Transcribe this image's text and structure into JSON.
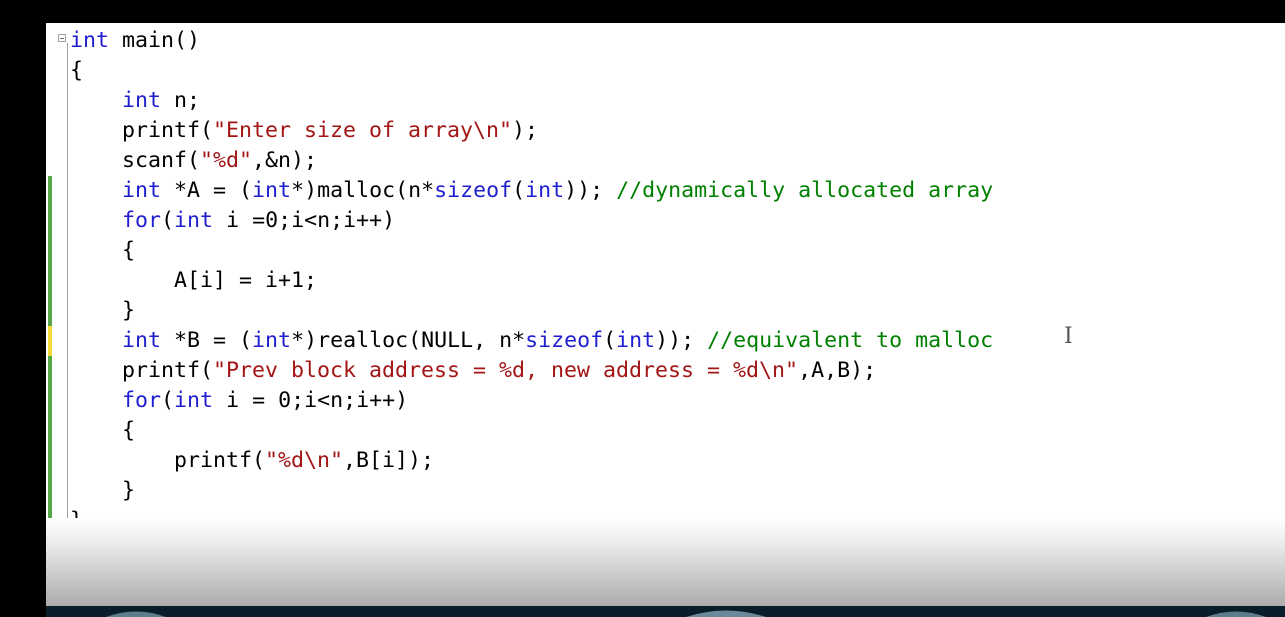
{
  "editor": {
    "lines": [
      {
        "indent": "",
        "tokens": [
          {
            "t": "int",
            "k": "kw"
          },
          {
            "t": " main()",
            "k": ""
          }
        ]
      },
      {
        "indent": "",
        "tokens": [
          {
            "t": "{",
            "k": ""
          }
        ]
      },
      {
        "indent": "    ",
        "tokens": [
          {
            "t": "int",
            "k": "kw"
          },
          {
            "t": " n;",
            "k": ""
          }
        ]
      },
      {
        "indent": "    ",
        "tokens": [
          {
            "t": "printf(",
            "k": ""
          },
          {
            "t": "\"Enter size of array\\n\"",
            "k": "str"
          },
          {
            "t": ");",
            "k": ""
          }
        ]
      },
      {
        "indent": "    ",
        "tokens": [
          {
            "t": "scanf(",
            "k": ""
          },
          {
            "t": "\"%d\"",
            "k": "str"
          },
          {
            "t": ",&n);",
            "k": ""
          }
        ]
      },
      {
        "indent": "    ",
        "tokens": [
          {
            "t": "int",
            "k": "kw"
          },
          {
            "t": " *A = (",
            "k": ""
          },
          {
            "t": "int",
            "k": "kw"
          },
          {
            "t": "*)malloc(n*",
            "k": ""
          },
          {
            "t": "sizeof",
            "k": "kw"
          },
          {
            "t": "(",
            "k": ""
          },
          {
            "t": "int",
            "k": "kw"
          },
          {
            "t": ")); ",
            "k": ""
          },
          {
            "t": "//dynamically allocated array",
            "k": "cm"
          }
        ]
      },
      {
        "indent": "    ",
        "tokens": [
          {
            "t": "for",
            "k": "kw"
          },
          {
            "t": "(",
            "k": ""
          },
          {
            "t": "int",
            "k": "kw"
          },
          {
            "t": " i =0;i<n;i++)",
            "k": ""
          }
        ]
      },
      {
        "indent": "    ",
        "tokens": [
          {
            "t": "{",
            "k": ""
          }
        ]
      },
      {
        "indent": "        ",
        "tokens": [
          {
            "t": "A[i] = i+1;",
            "k": ""
          }
        ]
      },
      {
        "indent": "    ",
        "tokens": [
          {
            "t": "}",
            "k": ""
          }
        ]
      },
      {
        "indent": "    ",
        "tokens": [
          {
            "t": "int",
            "k": "kw"
          },
          {
            "t": " *B = (",
            "k": ""
          },
          {
            "t": "int",
            "k": "kw"
          },
          {
            "t": "*)realloc(NULL, n*",
            "k": ""
          },
          {
            "t": "sizeof",
            "k": "kw"
          },
          {
            "t": "(",
            "k": ""
          },
          {
            "t": "int",
            "k": "kw"
          },
          {
            "t": ")); ",
            "k": ""
          },
          {
            "t": "//equivalent to malloc",
            "k": "cm"
          }
        ]
      },
      {
        "indent": "    ",
        "tokens": [
          {
            "t": "printf(",
            "k": ""
          },
          {
            "t": "\"Prev block address = %d, new address = %d\\n\"",
            "k": "str"
          },
          {
            "t": ",A,B);",
            "k": ""
          }
        ]
      },
      {
        "indent": "    ",
        "tokens": [
          {
            "t": "for",
            "k": "kw"
          },
          {
            "t": "(",
            "k": ""
          },
          {
            "t": "int",
            "k": "kw"
          },
          {
            "t": " i = 0;i<n;i++)",
            "k": ""
          }
        ]
      },
      {
        "indent": "    ",
        "tokens": [
          {
            "t": "{",
            "k": ""
          }
        ]
      },
      {
        "indent": "        ",
        "tokens": [
          {
            "t": "printf(",
            "k": ""
          },
          {
            "t": "\"%d\\n\"",
            "k": "str"
          },
          {
            "t": ",B[i]);",
            "k": ""
          }
        ]
      },
      {
        "indent": "    ",
        "tokens": [
          {
            "t": "}",
            "k": ""
          }
        ]
      },
      {
        "indent": "",
        "tokens": [
          {
            "t": "}",
            "k": ""
          }
        ]
      }
    ],
    "change_markers": [
      {
        "line": 5,
        "status": "saved"
      },
      {
        "line": 6,
        "status": "saved"
      },
      {
        "line": 7,
        "status": "saved"
      },
      {
        "line": 8,
        "status": "saved"
      },
      {
        "line": 9,
        "status": "saved"
      },
      {
        "line": 10,
        "status": "unsaved"
      },
      {
        "line": 11,
        "status": "saved"
      },
      {
        "line": 12,
        "status": "saved"
      },
      {
        "line": 13,
        "status": "saved"
      },
      {
        "line": 14,
        "status": "saved"
      },
      {
        "line": 15,
        "status": "saved"
      },
      {
        "line": 16,
        "status": "saved"
      }
    ],
    "colors": {
      "keyword": "#1f1fd0",
      "string": "#a31515",
      "comment": "#008000",
      "saved_marker": "#57a64a",
      "unsaved_marker": "#f5d83b"
    },
    "icons": {
      "collapse": "collapse-minus-icon",
      "cursor": "i-beam-cursor-icon"
    }
  }
}
